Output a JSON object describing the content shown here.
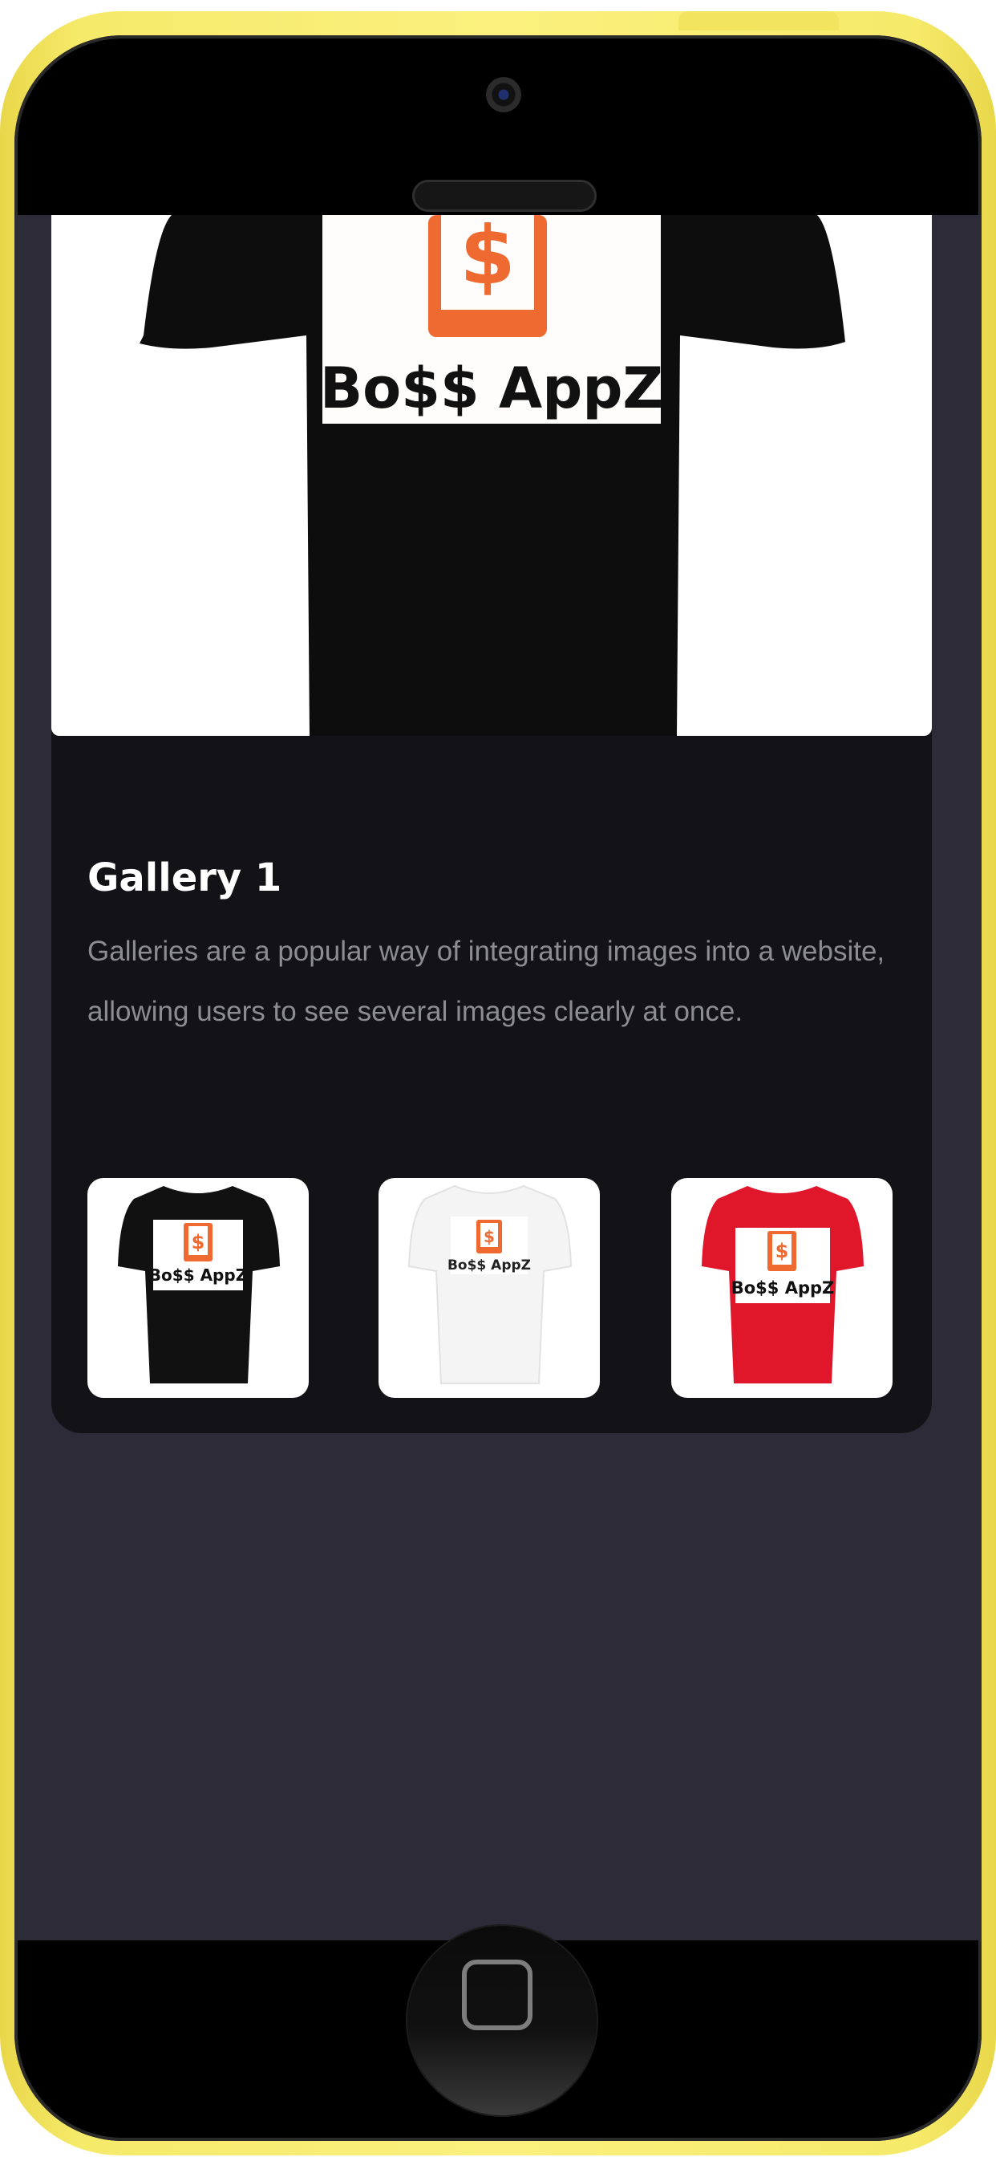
{
  "hero": {
    "shirt_color": "#0d0d0d",
    "logo_text": "Bo$$ AppZ",
    "logo_color": "#ee6a31"
  },
  "gallery": {
    "title": "Gallery 1",
    "description": "Galleries are a popular way of integrating images into a website, allowing users to see several images clearly at once.",
    "thumbnails": [
      {
        "shirt_color": "#111111",
        "logo_text": "Bo$$ AppZ"
      },
      {
        "shirt_color": "#f4f4f4",
        "logo_text": "Bo$$ AppZ"
      },
      {
        "shirt_color": "#e0162b",
        "logo_text": "Bo$$ AppZ"
      }
    ]
  },
  "colors": {
    "frame": "#f6ea6a",
    "screen_bg": "#2c2b37",
    "card_bg": "#121217",
    "accent": "#ee6a31"
  }
}
